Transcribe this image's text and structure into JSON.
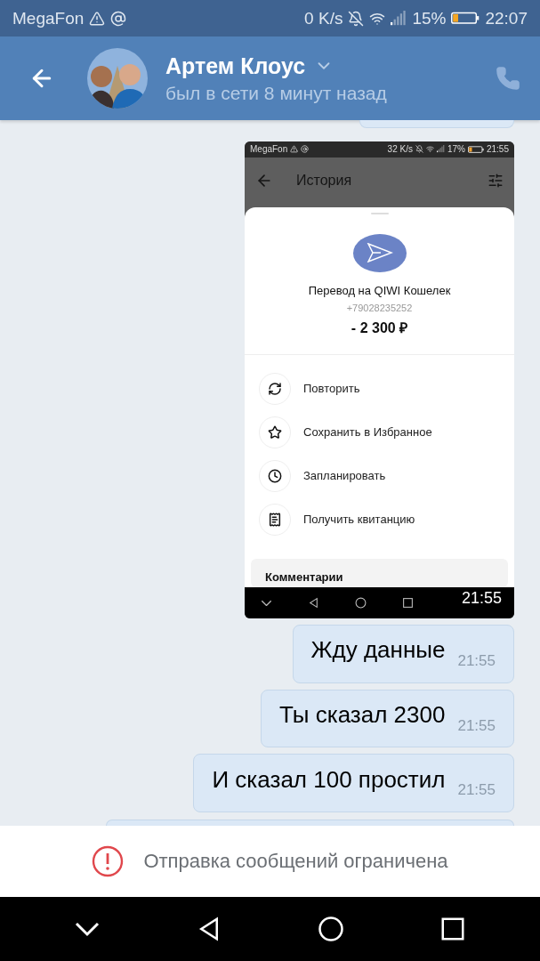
{
  "status_bar": {
    "carrier": "MegaFon",
    "speed": "0 K/s",
    "battery": "15%",
    "time": "22:07"
  },
  "header": {
    "name": "Артем Клоус",
    "status": "был в сети 8 минут назад"
  },
  "messages": [
    {
      "kind": "screenshot",
      "time": "21:55",
      "screen": {
        "status_bar": {
          "carrier": "MegaFon",
          "speed": "32 K/s",
          "battery": "17%",
          "time": "21:55"
        },
        "title": "История",
        "transfer": {
          "title": "Перевод на QIWI Кошелек",
          "phone": "+79028235252",
          "amount": "- 2 300 ₽"
        },
        "actions": [
          {
            "kind": "repeat",
            "label": "Повторить"
          },
          {
            "kind": "favorite",
            "label": "Сохранить в Избранное"
          },
          {
            "kind": "schedule",
            "label": "Запланировать"
          },
          {
            "kind": "receipt",
            "label": "Получить квитанцию"
          }
        ],
        "comments_label": "Комментарии"
      }
    },
    {
      "kind": "text",
      "text": "Жду данные",
      "time": "21:55"
    },
    {
      "kind": "text",
      "text": "Ты сказал 2300",
      "time": "21:55"
    },
    {
      "kind": "text",
      "text": "И сказал 100 простил",
      "time": "21:55"
    }
  ],
  "notice": "Отправка сообщений ограничена"
}
